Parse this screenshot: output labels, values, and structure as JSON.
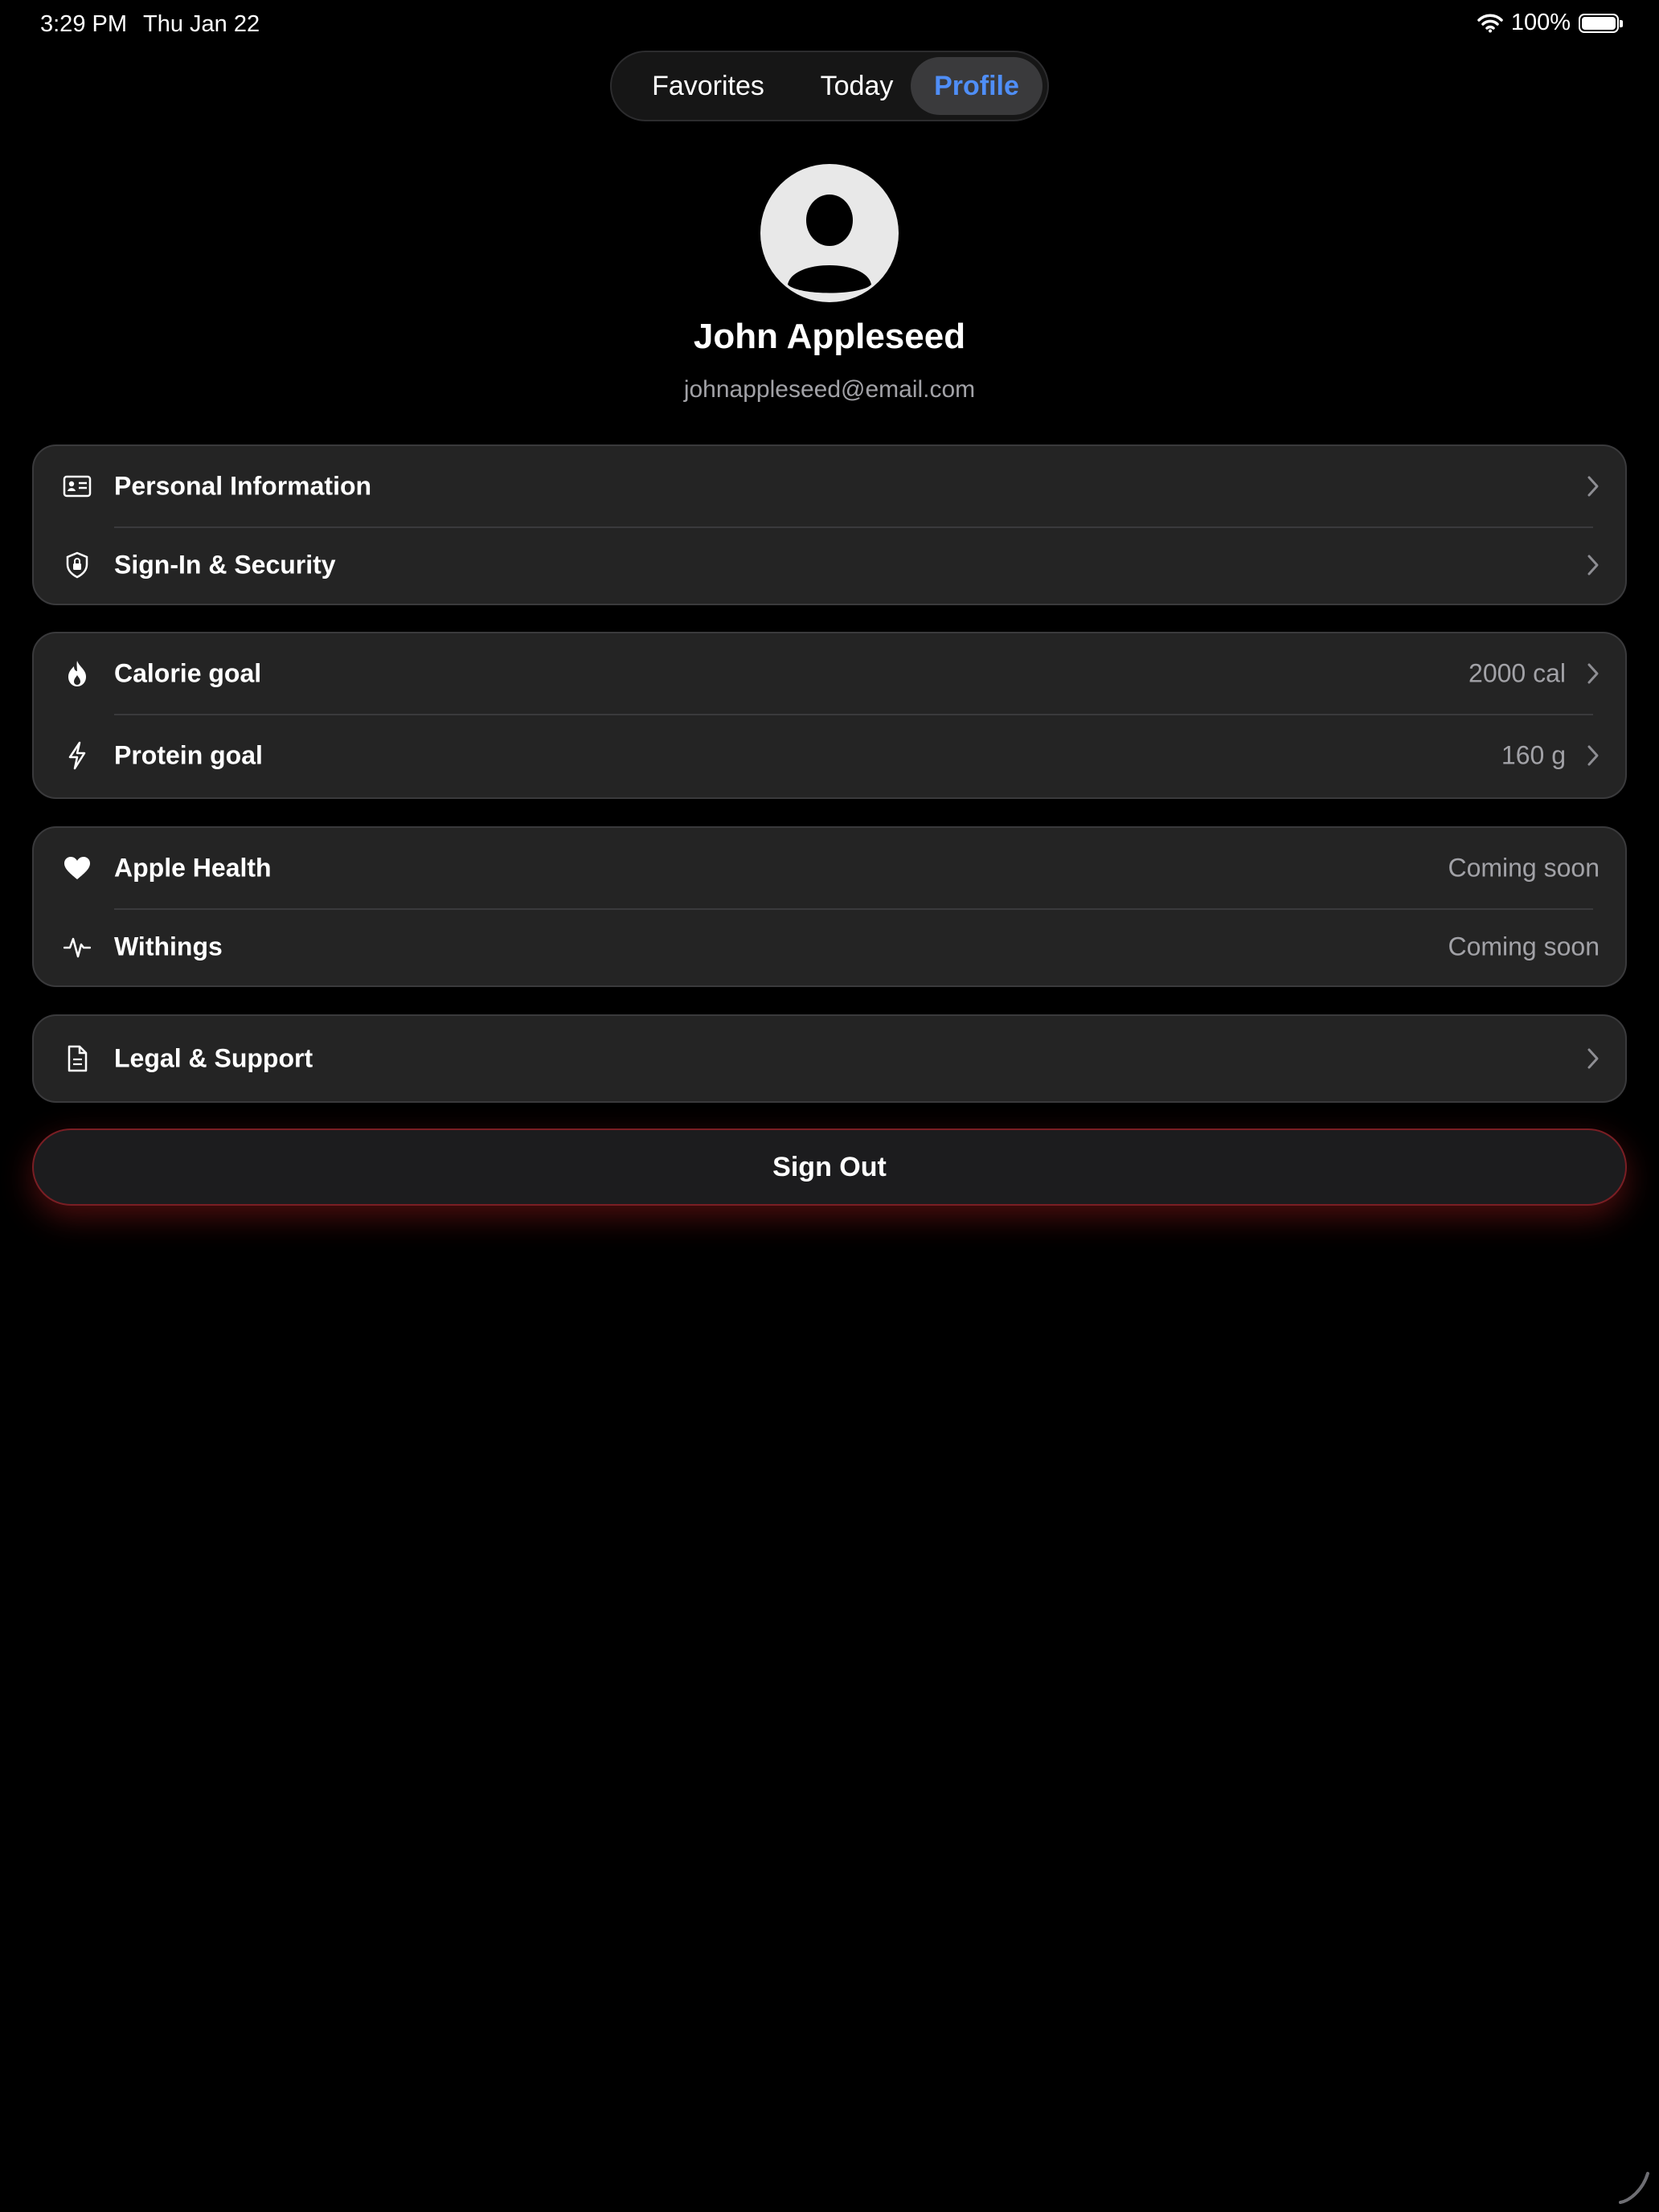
{
  "status_bar": {
    "time": "3:29 PM",
    "date": "Thu Jan 22",
    "battery": "100%"
  },
  "tabs": [
    {
      "label": "Favorites",
      "selected": false
    },
    {
      "label": "Today",
      "selected": false
    },
    {
      "label": "Profile",
      "selected": true
    }
  ],
  "profile": {
    "name": "John Appleseed",
    "email": "johnappleseed@email.com"
  },
  "account": [
    {
      "label": "Personal Information",
      "icon": "id-card-icon"
    },
    {
      "label": "Sign-In & Security",
      "icon": "shield-lock-icon"
    }
  ],
  "goals": [
    {
      "label": "Calorie goal",
      "value": "2000 cal",
      "icon": "flame-icon"
    },
    {
      "label": "Protein goal",
      "value": "160 g",
      "icon": "bolt-icon"
    }
  ],
  "integrations": [
    {
      "label": "Apple Health",
      "value": "Coming soon",
      "icon": "heart-icon"
    },
    {
      "label": "Withings",
      "value": "Coming soon",
      "icon": "waveform-icon"
    }
  ],
  "support": [
    {
      "label": "Legal & Support",
      "icon": "document-icon"
    }
  ],
  "sign_out_label": "Sign Out",
  "colors": {
    "accent": "#4f8ef7",
    "background": "#000000",
    "card": "#242424",
    "sign_out_glow": "#dc2828"
  }
}
